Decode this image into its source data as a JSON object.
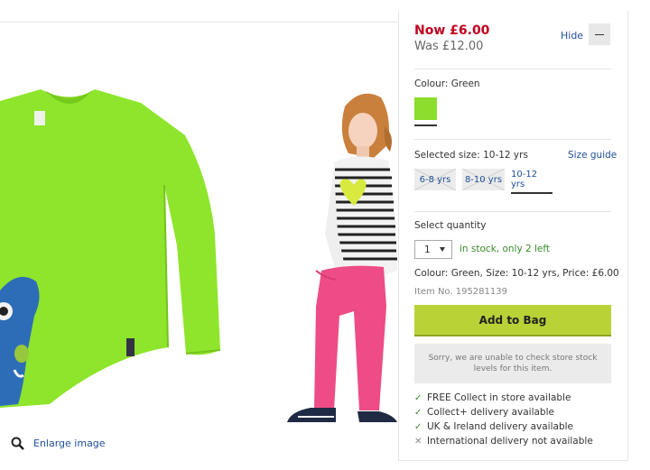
{
  "price": {
    "now": "Now £6.00",
    "was": "Was £12.00"
  },
  "panel": {
    "hide_label": "Hide"
  },
  "colour": {
    "label": "Colour: Green",
    "swatch_color": "#8ddd2c"
  },
  "size": {
    "label": "Selected size: 10-12 yrs",
    "guide_label": "Size guide",
    "options": [
      {
        "label": "6-8 yrs",
        "available": false
      },
      {
        "label": "8-10 yrs",
        "available": false
      },
      {
        "label": "10-12 yrs",
        "available": true,
        "selected": true
      }
    ]
  },
  "quantity": {
    "title": "Select quantity",
    "value": "1",
    "stock": "in stock, only 2 left"
  },
  "summary": "Colour: Green, Size: 10-12 yrs, Price: £6.00",
  "item_number": "Item No. 195281139",
  "add_to_bag": "Add to Bag",
  "store_message": "Sorry, we are unable to check store stock levels for this item.",
  "delivery": [
    {
      "icon": "check-icon",
      "text": "FREE Collect in store available"
    },
    {
      "icon": "check-icon",
      "text": "Collect+ delivery available"
    },
    {
      "icon": "check-icon",
      "text": "UK & Ireland delivery available"
    },
    {
      "icon": "cross-icon",
      "text": "International delivery not available"
    }
  ],
  "enlarge_label": "Enlarge image",
  "colors": {
    "price_now": "#c1001f",
    "link": "#1f4e99",
    "add_button": "#b9d236",
    "in_stock": "#3a8a2a"
  }
}
